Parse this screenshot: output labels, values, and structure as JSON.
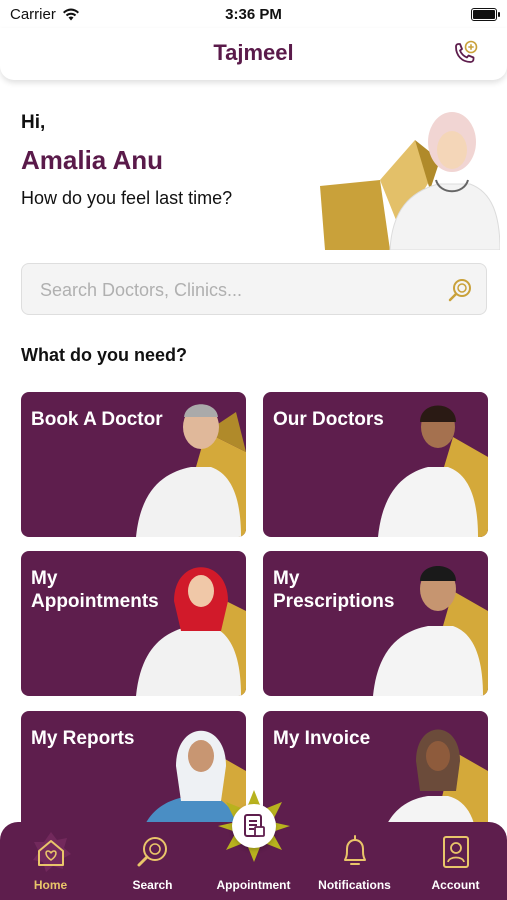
{
  "status_bar": {
    "carrier": "Carrier",
    "time": "3:36 PM"
  },
  "header": {
    "title": "Tajmeel",
    "call_icon": "phone-plus-icon"
  },
  "greeting": {
    "hi": "Hi,",
    "name": "Amalia Anu",
    "subtitle": "How do you feel last time?"
  },
  "search": {
    "placeholder": "Search Doctors, Clinics...",
    "value": ""
  },
  "section_title": "What do you need?",
  "cards": [
    {
      "label": "Book A Doctor"
    },
    {
      "label": "Our Doctors"
    },
    {
      "label": "My\nAppointments"
    },
    {
      "label": "My\nPrescriptions"
    },
    {
      "label": "My Reports"
    },
    {
      "label": "My Invoice"
    }
  ],
  "nav": {
    "items": [
      {
        "label": "Home",
        "icon": "home-heart-icon"
      },
      {
        "label": "Search",
        "icon": "search-icon"
      },
      {
        "label": "Appointment",
        "icon": "appointment-icon"
      },
      {
        "label": "Notifications",
        "icon": "bell-icon"
      },
      {
        "label": "Account",
        "icon": "account-icon"
      }
    ]
  },
  "colors": {
    "brand": "#5e1e4d",
    "accent_gold": "#d4a93a",
    "active_tab": "#e9c56a"
  }
}
